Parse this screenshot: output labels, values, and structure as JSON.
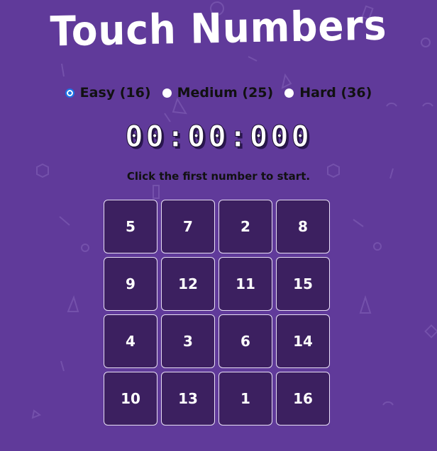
{
  "title": "Touch Numbers",
  "modes": [
    {
      "label": "Easy (16)",
      "checked": true
    },
    {
      "label": "Medium (25)",
      "checked": false
    },
    {
      "label": "Hard (36)",
      "checked": false
    }
  ],
  "timer": "00:00:000",
  "status": "Click the first number to start.",
  "grid": [
    5,
    7,
    2,
    8,
    9,
    12,
    11,
    15,
    4,
    3,
    6,
    14,
    10,
    13,
    1,
    16
  ],
  "colors": {
    "background": "#603a9a",
    "cell": "#3c2060",
    "cell_border": "#e8dff5",
    "radio_selected": "#1a73e8"
  }
}
